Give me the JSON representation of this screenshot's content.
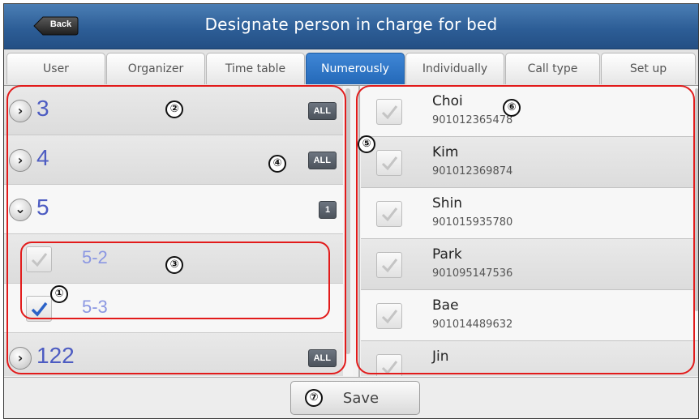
{
  "window": {
    "title": "Designate person in charge for bed",
    "back_label": "Back"
  },
  "tabs": [
    {
      "label": "User",
      "active": false
    },
    {
      "label": "Organizer",
      "active": false
    },
    {
      "label": "Time table",
      "active": false
    },
    {
      "label": "Numerously",
      "active": true
    },
    {
      "label": "Individually",
      "active": false
    },
    {
      "label": "Call type",
      "active": false
    },
    {
      "label": "Set up",
      "active": false
    }
  ],
  "groups": [
    {
      "label": "3",
      "expanded": false,
      "badge": "ALL"
    },
    {
      "label": "4",
      "expanded": false,
      "badge": "ALL"
    },
    {
      "label": "5",
      "expanded": true,
      "badge": "1"
    },
    {
      "label": "122",
      "expanded": false,
      "badge": "ALL"
    }
  ],
  "subitems": [
    {
      "label": "5-2",
      "checked": false
    },
    {
      "label": "5-3",
      "checked": true
    }
  ],
  "people": [
    {
      "name": "Choi",
      "number": "901012365478",
      "checked": false
    },
    {
      "name": "Kim",
      "number": "901012369874",
      "checked": false
    },
    {
      "name": "Shin",
      "number": "901015935780",
      "checked": false
    },
    {
      "name": "Park",
      "number": "901095147536",
      "checked": false
    },
    {
      "name": "Bae",
      "number": "901014489632",
      "checked": false
    },
    {
      "name": "Jin",
      "number": "",
      "checked": false
    }
  ],
  "footer": {
    "save_label": "Save"
  },
  "annotations": [
    "①",
    "②",
    "③",
    "④",
    "⑤",
    "⑥",
    "⑦"
  ],
  "colors": {
    "title_bar": "#2d5e97",
    "active_tab": "#2d74c4",
    "group_label": "#4d5cc2",
    "sub_label": "#8b97e2",
    "annotation": "#e21b1b",
    "check_on": "#2a62c8"
  }
}
